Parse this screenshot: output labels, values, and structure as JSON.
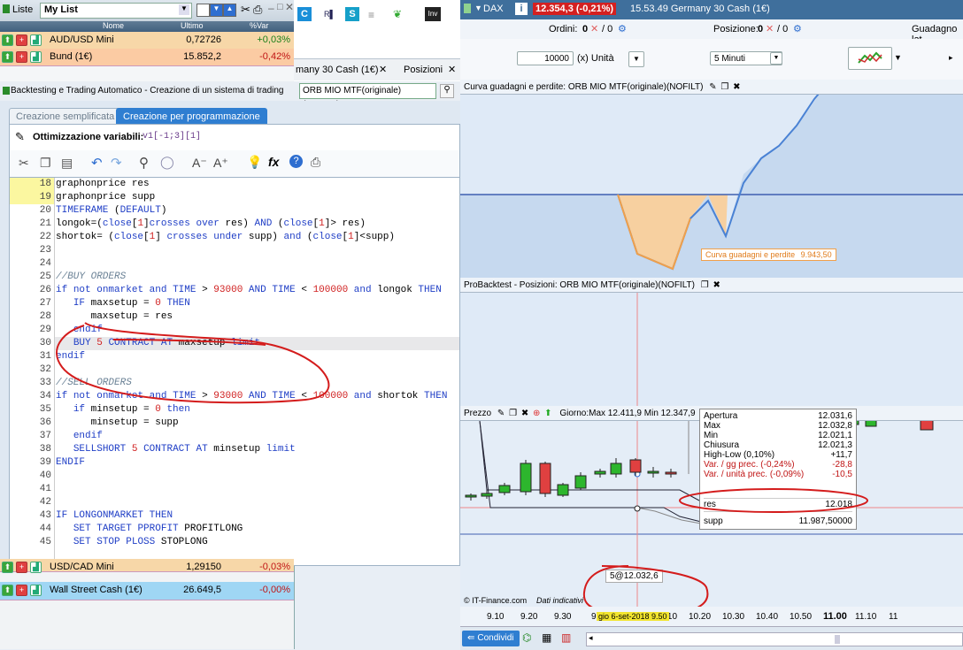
{
  "watchlist": {
    "tab_label": "Liste",
    "list_name": "My List",
    "columns": [
      "Nome",
      "Ultimo",
      "%Var"
    ],
    "rows": [
      {
        "name": "AUD/USD Mini",
        "last": "0,72726",
        "change": "+0,03%",
        "bg": "#f7d7a8",
        "changeColor": "#1a7f1a"
      },
      {
        "name": "Bund (1€)",
        "last": "15.852,2",
        "change": "-0,42%",
        "bg": "#fbcba3",
        "changeColor": "#c01515"
      }
    ],
    "bottom_rows": [
      {
        "name": "USD/CAD Mini",
        "last": "1,29150",
        "change": "-0,03%",
        "bg": "#f7d7a8"
      },
      {
        "name": "Wall Street Cash (1€)",
        "last": "26.649,5",
        "change": "-0,00%",
        "bg": "#9fd6f4"
      }
    ]
  },
  "middle": {
    "tab1": "many 30 Cash (1€)",
    "tab2": "Posizioni"
  },
  "backtest": {
    "title": "Backtesting e Trading Automatico - Creazione di un sistema di trading",
    "system_name": "ORB MIO MTF(originale)(NOFILT)",
    "tab_simple": "Creazione semplificata",
    "tab_programming": "Creazione per programmazione",
    "optimization_label": "Ottimizzazione variabili:",
    "optimization_value": "v1[-1;3][1]"
  },
  "code_lines": [
    {
      "n": "18",
      "t": "graphonprice res"
    },
    {
      "n": "19",
      "t": "graphonprice supp"
    },
    {
      "n": "20",
      "t": "TIMEFRAME (DEFAULT)"
    },
    {
      "n": "21",
      "t": "longok=(close[1]crosses over res) AND (close[1]> res)"
    },
    {
      "n": "22",
      "t": "shortok= (close[1] crosses under supp) and (close[1]<supp)"
    },
    {
      "n": "23",
      "t": ""
    },
    {
      "n": "24",
      "t": ""
    },
    {
      "n": "25",
      "t": "//BUY ORDERS"
    },
    {
      "n": "26",
      "t": "if not onmarket and TIME > 93000 AND TIME < 100000 and longok THEN"
    },
    {
      "n": "27",
      "t": "   IF maxsetup = 0 THEN"
    },
    {
      "n": "28",
      "t": "      maxsetup = res"
    },
    {
      "n": "29",
      "t": "   endif"
    },
    {
      "n": "30",
      "t": "   BUY 5 CONTRACT AT maxsetup limit"
    },
    {
      "n": "31",
      "t": "endif"
    },
    {
      "n": "32",
      "t": ""
    },
    {
      "n": "33",
      "t": "//SELL ORDERS"
    },
    {
      "n": "34",
      "t": "if not onmarket and TIME > 93000 AND TIME < 100000 and shortok THEN"
    },
    {
      "n": "35",
      "t": "   if minsetup = 0 then"
    },
    {
      "n": "36",
      "t": "      minsetup = supp"
    },
    {
      "n": "37",
      "t": "   endif"
    },
    {
      "n": "38",
      "t": "   SELLSHORT 5 CONTRACT AT minsetup limit"
    },
    {
      "n": "39",
      "t": "ENDIF"
    },
    {
      "n": "40",
      "t": ""
    },
    {
      "n": "41",
      "t": ""
    },
    {
      "n": "42",
      "t": ""
    },
    {
      "n": "43",
      "t": "IF LONGONMARKET THEN"
    },
    {
      "n": "44",
      "t": "   SET TARGET PPROFIT PROFITLONG"
    },
    {
      "n": "45",
      "t": "   SET STOP PLOSS STOPLONG"
    }
  ],
  "instrument": {
    "menu": "DAX",
    "price_badge": "12.354,3 (-0,21%)",
    "time_name": "15.53.49 Germany 30 Cash (1€)",
    "orders_label": "Ordini:",
    "orders_value": "0",
    "orders_slash": "/ 0",
    "position_label": "Posizione:",
    "position_value": "0",
    "position_slash": "/ 0",
    "gain_label": "Guadagno lat",
    "quantity": "10000",
    "unit_label": "(x) Unità",
    "timeframe": "5 Minuti"
  },
  "equity_panel": {
    "title": "Curva guadagni e perdite: ORB MIO MTF(originale)(NOFILT)",
    "label": "Curva guadagni e perdite",
    "value": "9.943,50"
  },
  "positions_panel": {
    "title": "ProBacktest - Posizioni: ORB MIO MTF(originale)(NOFILT)"
  },
  "price_panel": {
    "title": "Prezzo",
    "day_info": "Giorno:Max 12.411,9 Min 12.347,9",
    "tooltip": [
      {
        "k": "Apertura",
        "v": "12.031,6",
        "c": "#000"
      },
      {
        "k": "Max",
        "v": "12.032,8",
        "c": "#000"
      },
      {
        "k": "Min",
        "v": "12.021,1",
        "c": "#000"
      },
      {
        "k": "Chiusura",
        "v": "12.021,3",
        "c": "#000"
      },
      {
        "k": "High-Low (0,10%)",
        "v": "+11,7",
        "c": "#000"
      },
      {
        "k": "Var. / gg prec. (-0,24%)",
        "v": "-28,8",
        "c": "#c01515"
      },
      {
        "k": "Var. / unità prec. (-0,09%)",
        "v": "-10,5",
        "c": "#c01515"
      }
    ],
    "res_label": "res",
    "res_value": "12.018",
    "supp_label": "supp",
    "supp_value": "11.987,50000",
    "order_marker": "5@12.032,6",
    "source": "© IT-Finance.com",
    "source_note": "Dati indicativi"
  },
  "time_axis": {
    "ticks": [
      "9.10",
      "9.20",
      "9.30",
      "9",
      "10.10",
      "10.20",
      "10.30",
      "10.40",
      "10.50",
      "11.00",
      "11.10",
      "11"
    ],
    "highlight": "gio 6-set-2018 9.50"
  },
  "bottom": {
    "share": "Condividi"
  }
}
